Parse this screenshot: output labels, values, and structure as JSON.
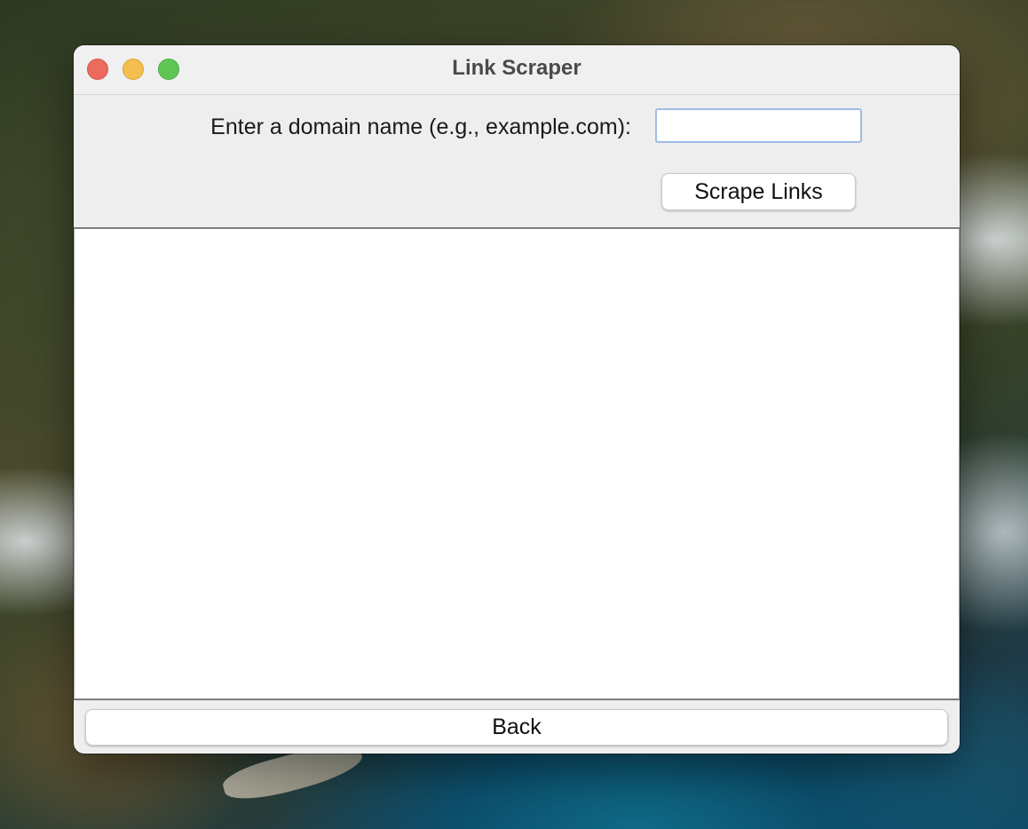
{
  "window": {
    "title": "Link Scraper",
    "traffic_lights": {
      "close_color": "#ec6a5e",
      "minimize_color": "#f4bf4f",
      "maximize_color": "#61c554"
    }
  },
  "form": {
    "domain_label": "Enter a domain name (e.g., example.com):",
    "domain_value": "",
    "scrape_button_label": "Scrape Links"
  },
  "results": {
    "text": ""
  },
  "footer": {
    "back_button_label": "Back"
  },
  "colors": {
    "input_focus_border": "#9fbde4",
    "window_background": "#eeeeee"
  }
}
